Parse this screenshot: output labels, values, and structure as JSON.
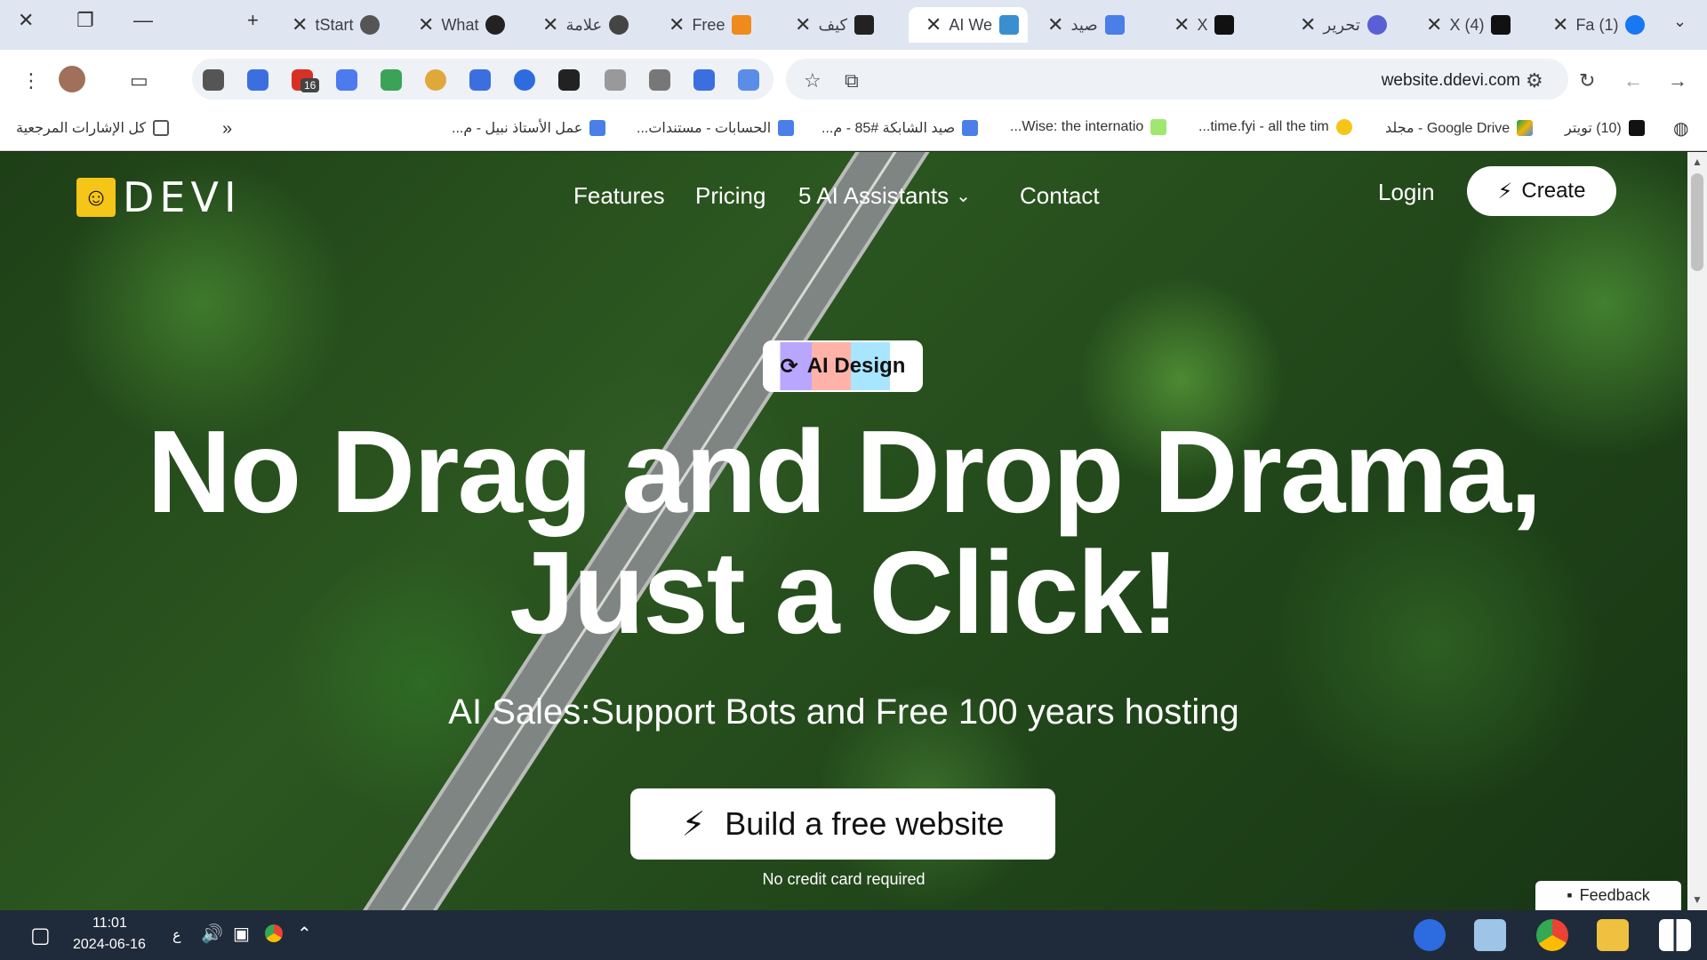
{
  "browser": {
    "tabs": [
      {
        "label": "tStart"
      },
      {
        "label": "What"
      },
      {
        "label": "علامة"
      },
      {
        "label": "Free"
      },
      {
        "label": "كيف"
      },
      {
        "label": "AI We"
      },
      {
        "label": "صيد"
      },
      {
        "label": "X"
      },
      {
        "label": "تحرير"
      },
      {
        "label": "(4) X"
      },
      {
        "label": "(1) Fa"
      }
    ],
    "url": "website.ddevi.com",
    "extension_badge": "16",
    "bookmarks": [
      {
        "label": "كل الإشارات المرجعية"
      },
      {
        "label": "عمل الأستاذ نبيل - م..."
      },
      {
        "label": "الحسابات - مستندات..."
      },
      {
        "label": "صيد الشابكة #85 - م..."
      },
      {
        "label": "Wise: the internatio..."
      },
      {
        "label": "time.fyi - all the tim..."
      },
      {
        "label": "Google Drive - مجلد"
      },
      {
        "label": "(10) تويتر"
      }
    ]
  },
  "site": {
    "logo_text": "DEVI",
    "nav": {
      "features": "Features",
      "pricing": "Pricing",
      "assistants": "5 AI Assistants",
      "contact": "Contact",
      "login": "Login",
      "create": "Create"
    },
    "badge": "AI Design",
    "headline_line1": "No Drag and Drop Drama,",
    "headline_line2": "Just a Click!",
    "subtitle": "AI Sales:Support Bots and Free 100 years hosting",
    "cta": "Build a free website",
    "cta_note": "No credit card required",
    "feedback": "Feedback"
  },
  "taskbar": {
    "time": "11:01",
    "date": "2024-06-16",
    "lang": "ع"
  },
  "colors": {
    "logo_yellow": "#f5c518",
    "taskbar": "#1f2b3a",
    "tabstrip": "#dfe6f2"
  }
}
